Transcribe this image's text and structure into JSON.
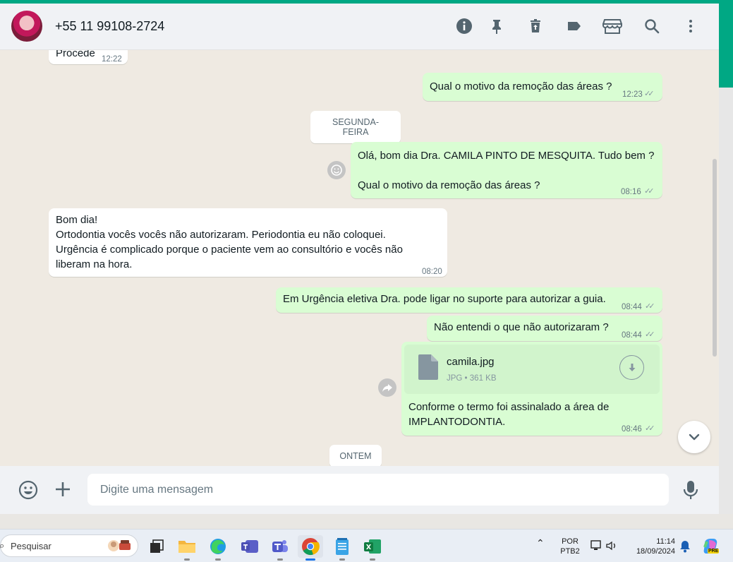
{
  "header": {
    "contact_name": "+55 11 99108-2724",
    "icons": [
      "info-icon",
      "pin-icon",
      "delete-icon",
      "label-icon",
      "store-icon",
      "search-icon",
      "more-vert-icon"
    ]
  },
  "messages": {
    "m0": {
      "text": "Procede",
      "time": "12:22"
    },
    "m1": {
      "text": "Qual o motivo da remoção das áreas ?",
      "time": "12:23"
    },
    "date1": "SEGUNDA-FEIRA",
    "m2": {
      "line1": "Olá, bom dia Dra. CAMILA PINTO DE MESQUITA. Tudo bem ?",
      "line2": "Qual o motivo da remoção das áreas ?",
      "time": "08:16"
    },
    "m3": {
      "line1": "Bom dia!",
      "line2": "Ortodontia vocês vocês não autorizaram. Periodontia eu não coloquei.",
      "line3": "Urgência é complicado porque o paciente vem ao consultório e vocês não",
      "line4": "liberam na hora.",
      "time": "08:20"
    },
    "m4": {
      "text": "Em Urgência eletiva Dra. pode ligar no suporte para autorizar a guia.",
      "time": "08:44"
    },
    "m5": {
      "text": "Não entendi o que não autorizaram ?",
      "time": "08:44"
    },
    "m6": {
      "file_name": "camila.jpg",
      "file_meta": "JPG • 361 KB",
      "line1": "Conforme o termo foi assinalado a área de",
      "line2": "IMPLANTODONTIA.",
      "time": "08:46"
    },
    "date2": "ONTEM"
  },
  "composer": {
    "placeholder": "Digite uma mensagem"
  },
  "taskbar": {
    "search_label": "Pesquisar",
    "lang1": "POR",
    "lang2": "PTB2",
    "clock_time": "11:14",
    "clock_date": "18/09/2024",
    "copilot_badge": "PRE"
  },
  "colors": {
    "accent": "#00a884",
    "outgoing": "#d9fdd3",
    "incoming": "#ffffff",
    "chat_bg": "#efeae2"
  }
}
